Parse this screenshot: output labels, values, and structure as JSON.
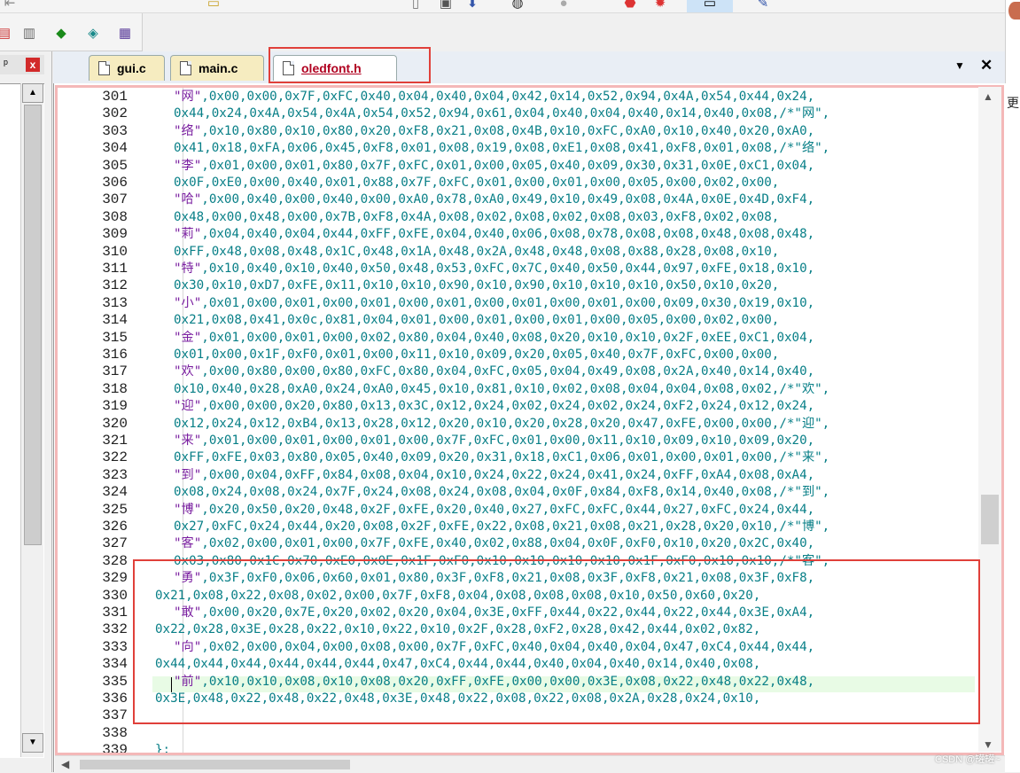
{
  "tabs": [
    {
      "label": "gui.c"
    },
    {
      "label": "main.c"
    },
    {
      "label": "oledfont.h",
      "active": true
    }
  ],
  "icons": {
    "tab_menu": "chevron-down-icon",
    "tab_close": "close-icon",
    "panel_pin": "pin-icon",
    "panel_close": "close-icon"
  },
  "symbols": {
    "tab_menu": "▼",
    "tab_close": "✕",
    "pin": "𝌆",
    "close": "x",
    "up": "▲",
    "down": "▼",
    "left": "◀"
  },
  "right_panel_char": "更",
  "watermark": "CSDN @罐罐~",
  "colors": {
    "highlight": "#e8fbe5",
    "annotation_red": "#e0403a",
    "code_teal": "#087f87",
    "string_purple": "#7a1fa0"
  },
  "editor": {
    "lines": [
      {
        "n": "301",
        "t": "\"网\",0x00,0x00,0x7F,0xFC,0x40,0x04,0x40,0x04,0x42,0x14,0x52,0x94,0x4A,0x54,0x44,0x24,"
      },
      {
        "n": "302",
        "t": "0x44,0x24,0x4A,0x54,0x4A,0x54,0x52,0x94,0x61,0x04,0x40,0x04,0x40,0x14,0x40,0x08,/*\"网\","
      },
      {
        "n": "303",
        "t": "\"络\",0x10,0x80,0x10,0x80,0x20,0xF8,0x21,0x08,0x4B,0x10,0xFC,0xA0,0x10,0x40,0x20,0xA0,"
      },
      {
        "n": "304",
        "t": "0x41,0x18,0xFA,0x06,0x45,0xF8,0x01,0x08,0x19,0x08,0xE1,0x08,0x41,0xF8,0x01,0x08,/*\"络\","
      },
      {
        "n": "305",
        "t": "\"李\",0x01,0x00,0x01,0x80,0x7F,0xFC,0x01,0x00,0x05,0x40,0x09,0x30,0x31,0x0E,0xC1,0x04,"
      },
      {
        "n": "306",
        "t": "0x0F,0xE0,0x00,0x40,0x01,0x88,0x7F,0xFC,0x01,0x00,0x01,0x00,0x05,0x00,0x02,0x00,"
      },
      {
        "n": "307",
        "t": "\"哈\",0x00,0x40,0x00,0x40,0x00,0xA0,0x78,0xA0,0x49,0x10,0x49,0x08,0x4A,0x0E,0x4D,0xF4,"
      },
      {
        "n": "308",
        "t": "0x48,0x00,0x48,0x00,0x7B,0xF8,0x4A,0x08,0x02,0x08,0x02,0x08,0x03,0xF8,0x02,0x08,"
      },
      {
        "n": "309",
        "t": "\"莉\",0x04,0x40,0x04,0x44,0xFF,0xFE,0x04,0x40,0x06,0x08,0x78,0x08,0x08,0x48,0x08,0x48,"
      },
      {
        "n": "310",
        "t": "0xFF,0x48,0x08,0x48,0x1C,0x48,0x1A,0x48,0x2A,0x48,0x48,0x08,0x88,0x28,0x08,0x10,"
      },
      {
        "n": "311",
        "t": "\"特\",0x10,0x40,0x10,0x40,0x50,0x48,0x53,0xFC,0x7C,0x40,0x50,0x44,0x97,0xFE,0x18,0x10,"
      },
      {
        "n": "312",
        "t": "0x30,0x10,0xD7,0xFE,0x11,0x10,0x10,0x90,0x10,0x90,0x10,0x10,0x10,0x50,0x10,0x20,"
      },
      {
        "n": "313",
        "t": "\"小\",0x01,0x00,0x01,0x00,0x01,0x00,0x01,0x00,0x01,0x00,0x01,0x00,0x09,0x30,0x19,0x10,"
      },
      {
        "n": "314",
        "t": "0x21,0x08,0x41,0x0c,0x81,0x04,0x01,0x00,0x01,0x00,0x01,0x00,0x05,0x00,0x02,0x00,"
      },
      {
        "n": "315",
        "t": "\"金\",0x01,0x00,0x01,0x00,0x02,0x80,0x04,0x40,0x08,0x20,0x10,0x10,0x2F,0xEE,0xC1,0x04,"
      },
      {
        "n": "316",
        "t": "0x01,0x00,0x1F,0xF0,0x01,0x00,0x11,0x10,0x09,0x20,0x05,0x40,0x7F,0xFC,0x00,0x00,"
      },
      {
        "n": "317",
        "t": "\"欢\",0x00,0x80,0x00,0x80,0xFC,0x80,0x04,0xFC,0x05,0x04,0x49,0x08,0x2A,0x40,0x14,0x40,"
      },
      {
        "n": "318",
        "t": "0x10,0x40,0x28,0xA0,0x24,0xA0,0x45,0x10,0x81,0x10,0x02,0x08,0x04,0x04,0x08,0x02,/*\"欢\","
      },
      {
        "n": "319",
        "t": "\"迎\",0x00,0x00,0x20,0x80,0x13,0x3C,0x12,0x24,0x02,0x24,0x02,0x24,0xF2,0x24,0x12,0x24,"
      },
      {
        "n": "320",
        "t": "0x12,0x24,0x12,0xB4,0x13,0x28,0x12,0x20,0x10,0x20,0x28,0x20,0x47,0xFE,0x00,0x00,/*\"迎\","
      },
      {
        "n": "321",
        "t": "\"来\",0x01,0x00,0x01,0x00,0x01,0x00,0x7F,0xFC,0x01,0x00,0x11,0x10,0x09,0x10,0x09,0x20,"
      },
      {
        "n": "322",
        "t": "0xFF,0xFE,0x03,0x80,0x05,0x40,0x09,0x20,0x31,0x18,0xC1,0x06,0x01,0x00,0x01,0x00,/*\"来\","
      },
      {
        "n": "323",
        "t": "\"到\",0x00,0x04,0xFF,0x84,0x08,0x04,0x10,0x24,0x22,0x24,0x41,0x24,0xFF,0xA4,0x08,0xA4,"
      },
      {
        "n": "324",
        "t": "0x08,0x24,0x08,0x24,0x7F,0x24,0x08,0x24,0x08,0x04,0x0F,0x84,0xF8,0x14,0x40,0x08,/*\"到\","
      },
      {
        "n": "325",
        "t": "\"博\",0x20,0x50,0x20,0x48,0x2F,0xFE,0x20,0x40,0x27,0xFC,0xFC,0x44,0x27,0xFC,0x24,0x44,"
      },
      {
        "n": "326",
        "t": "0x27,0xFC,0x24,0x44,0x20,0x08,0x2F,0xFE,0x22,0x08,0x21,0x08,0x21,0x28,0x20,0x10,/*\"博\","
      },
      {
        "n": "327",
        "t": "\"客\",0x02,0x00,0x01,0x00,0x7F,0xFE,0x40,0x02,0x88,0x04,0x0F,0xF0,0x10,0x20,0x2C,0x40,"
      },
      {
        "n": "328",
        "t": "0x03,0x80,0x1C,0x70,0xE0,0x0E,0x1F,0xF0,0x10,0x10,0x10,0x10,0x1F,0xF0,0x10,0x10,/*\"客\","
      },
      {
        "n": "329",
        "t": "\"勇\",0x3F,0xF0,0x06,0x60,0x01,0x80,0x3F,0xF8,0x21,0x08,0x3F,0xF8,0x21,0x08,0x3F,0xF8,"
      },
      {
        "n": "330",
        "t": "0x21,0x08,0x22,0x08,0x02,0x00,0x7F,0xF8,0x04,0x08,0x08,0x08,0x10,0x50,0x60,0x20,"
      },
      {
        "n": "331",
        "t": "\"敢\",0x00,0x20,0x7E,0x20,0x02,0x20,0x04,0x3E,0xFF,0x44,0x22,0x44,0x22,0x44,0x3E,0xA4,"
      },
      {
        "n": "332",
        "t": "0x22,0x28,0x3E,0x28,0x22,0x10,0x22,0x10,0x2F,0x28,0xF2,0x28,0x42,0x44,0x02,0x82,"
      },
      {
        "n": "333",
        "t": "\"向\",0x02,0x00,0x04,0x00,0x08,0x00,0x7F,0xFC,0x40,0x04,0x40,0x04,0x47,0xC4,0x44,0x44,"
      },
      {
        "n": "334",
        "t": "0x44,0x44,0x44,0x44,0x44,0x44,0x47,0xC4,0x44,0x44,0x40,0x04,0x40,0x14,0x40,0x08,"
      },
      {
        "n": "335",
        "t": "\"前\",0x10,0x10,0x08,0x10,0x08,0x20,0xFF,0xFE,0x00,0x00,0x3E,0x08,0x22,0x48,0x22,0x48,"
      },
      {
        "n": "336",
        "t": "0x3E,0x48,0x22,0x48,0x22,0x48,0x3E,0x48,0x22,0x08,0x22,0x08,0x2A,0x28,0x24,0x10,"
      },
      {
        "n": "337",
        "t": ""
      },
      {
        "n": "338",
        "t": ""
      },
      {
        "n": "339",
        "t": "};"
      }
    ]
  }
}
